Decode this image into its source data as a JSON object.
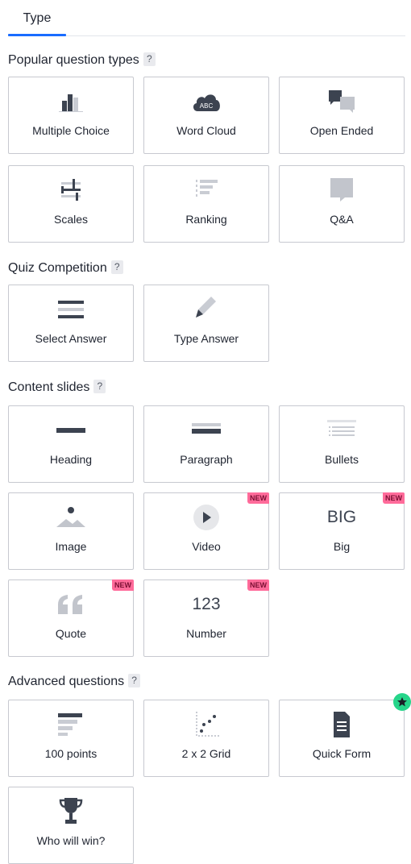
{
  "tab": {
    "label": "Type"
  },
  "sections": {
    "popular": {
      "title": "Popular question types",
      "help": "?"
    },
    "quiz": {
      "title": "Quiz Competition",
      "help": "?"
    },
    "content": {
      "title": "Content slides",
      "help": "?"
    },
    "advanced": {
      "title": "Advanced questions",
      "help": "?"
    }
  },
  "cards": {
    "multiple_choice": {
      "label": "Multiple Choice",
      "icon": "bar-chart-icon"
    },
    "word_cloud": {
      "label": "Word Cloud",
      "icon": "cloud-icon",
      "icon_text": "ABC"
    },
    "open_ended": {
      "label": "Open Ended",
      "icon": "speech-bubbles-icon"
    },
    "scales": {
      "label": "Scales",
      "icon": "sliders-icon"
    },
    "ranking": {
      "label": "Ranking",
      "icon": "ranking-icon"
    },
    "qa": {
      "label": "Q&A",
      "icon": "chat-bubble-icon"
    },
    "select_answer": {
      "label": "Select Answer",
      "icon": "list-lines-icon"
    },
    "type_answer": {
      "label": "Type Answer",
      "icon": "pencil-icon"
    },
    "heading": {
      "label": "Heading",
      "icon": "heading-icon"
    },
    "paragraph": {
      "label": "Paragraph",
      "icon": "paragraph-icon"
    },
    "bullets": {
      "label": "Bullets",
      "icon": "bullets-icon"
    },
    "image": {
      "label": "Image",
      "icon": "image-icon"
    },
    "video": {
      "label": "Video",
      "icon": "play-icon",
      "badge": "NEW"
    },
    "big": {
      "label": "Big",
      "icon_text": "BIG",
      "badge": "NEW"
    },
    "quote": {
      "label": "Quote",
      "icon": "quote-icon",
      "badge": "NEW"
    },
    "number": {
      "label": "Number",
      "icon_text": "123",
      "badge": "NEW"
    },
    "points100": {
      "label": "100 points",
      "icon": "descending-bars-icon"
    },
    "grid2x2": {
      "label": "2 x 2 Grid",
      "icon": "scatter-icon"
    },
    "quick_form": {
      "label": "Quick Form",
      "icon": "document-icon",
      "badge": "star"
    },
    "who_will_win": {
      "label": "Who will win?",
      "icon": "trophy-icon"
    }
  },
  "colors": {
    "accent": "#196cff",
    "icon_dark": "#3c4350",
    "icon_light": "#b7bac2",
    "new_badge": "#ff6b9a",
    "star_badge": "#26d58a",
    "border": "#c7c9d0"
  }
}
